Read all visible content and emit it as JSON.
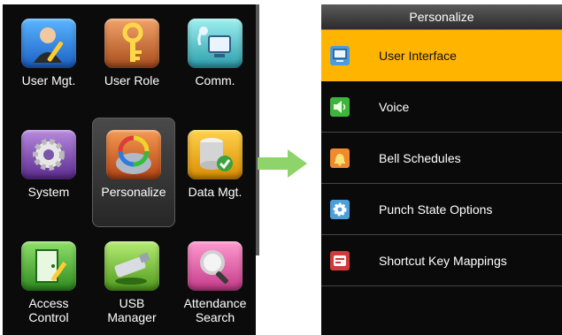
{
  "left_menu": {
    "tiles": [
      {
        "label": "User Mgt.",
        "icon": "user-icon"
      },
      {
        "label": "User Role",
        "icon": "key-icon"
      },
      {
        "label": "Comm.",
        "icon": "network-icon"
      },
      {
        "label": "System",
        "icon": "gear-icon"
      },
      {
        "label": "Personalize",
        "icon": "personalize-icon",
        "selected": true
      },
      {
        "label": "Data Mgt.",
        "icon": "database-icon"
      },
      {
        "label_line1": "Access",
        "label_line2": "Control",
        "icon": "access-control-icon"
      },
      {
        "label_line1": "USB",
        "label_line2": "Manager",
        "icon": "usb-icon"
      },
      {
        "label_line1": "Attendance",
        "label_line2": "Search",
        "icon": "magnifier-icon"
      }
    ]
  },
  "personalize_menu": {
    "title": "Personalize",
    "items": [
      {
        "label": "User Interface",
        "icon": "monitor-icon",
        "active": true
      },
      {
        "label": "Voice",
        "icon": "speaker-icon"
      },
      {
        "label": "Bell Schedules",
        "icon": "bell-icon"
      },
      {
        "label": "Punch State Options",
        "icon": "gear-icon"
      },
      {
        "label": "Shortcut Key Mappings",
        "icon": "keyboard-key-icon"
      }
    ]
  },
  "colors": {
    "highlight": "#ffb400",
    "arrow": "#8ed46a",
    "screen_background": "#0b0b0b"
  }
}
